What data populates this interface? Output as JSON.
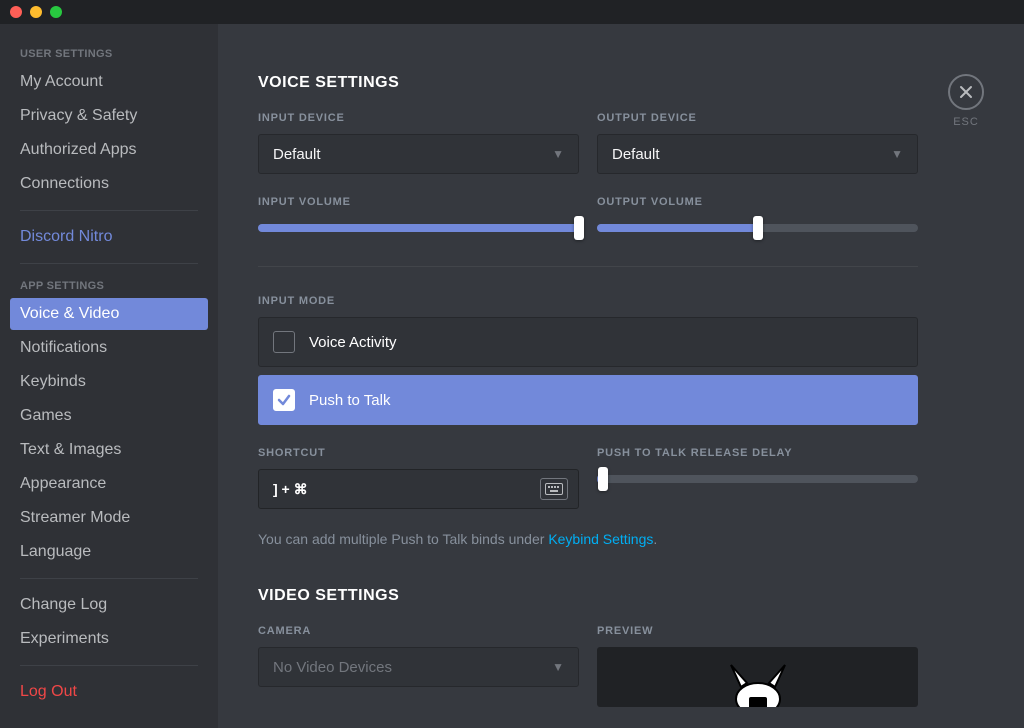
{
  "window": {
    "esc_label": "ESC"
  },
  "sidebar": {
    "user_header": "USER SETTINGS",
    "app_header": "APP SETTINGS",
    "user_items": [
      "My Account",
      "Privacy & Safety",
      "Authorized Apps",
      "Connections"
    ],
    "nitro": "Discord Nitro",
    "app_items": [
      "Voice & Video",
      "Notifications",
      "Keybinds",
      "Games",
      "Text & Images",
      "Appearance",
      "Streamer Mode",
      "Language"
    ],
    "misc_items": [
      "Change Log",
      "Experiments"
    ],
    "logout": "Log Out",
    "active": "Voice & Video"
  },
  "voice": {
    "heading": "VOICE SETTINGS",
    "input_device_label": "INPUT DEVICE",
    "input_device_value": "Default",
    "output_device_label": "OUTPUT DEVICE",
    "output_device_value": "Default",
    "input_volume_label": "INPUT VOLUME",
    "input_volume_percent": 100,
    "output_volume_label": "OUTPUT VOLUME",
    "output_volume_percent": 50,
    "input_mode_label": "INPUT MODE",
    "mode_voice_activity": "Voice Activity",
    "mode_push_to_talk": "Push to Talk",
    "mode_selected": "Push to Talk",
    "shortcut_label": "SHORTCUT",
    "shortcut_value": "] + ⌘",
    "ptt_delay_label": "PUSH TO TALK RELEASE DELAY",
    "ptt_delay_percent": 2,
    "hint_prefix": "You can add multiple Push to Talk binds under ",
    "hint_link": "Keybind Settings",
    "hint_suffix": "."
  },
  "video": {
    "heading": "VIDEO SETTINGS",
    "camera_label": "CAMERA",
    "camera_value": "No Video Devices",
    "preview_label": "PREVIEW"
  }
}
